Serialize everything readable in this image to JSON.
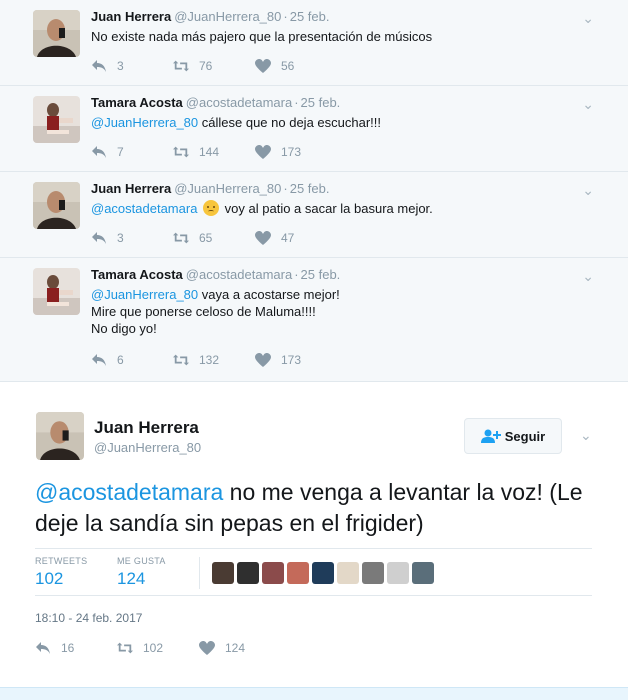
{
  "thread": [
    {
      "name": "Juan Herrera",
      "handle": "@JuanHerrera_80",
      "date": "25 feb.",
      "mention": "",
      "text": "No existe nada más pajero que la presentación de músicos",
      "replies": "3",
      "retweets": "76",
      "likes": "56",
      "avatar_color": "#3a2f28"
    },
    {
      "name": "Tamara Acosta",
      "handle": "@acostadetamara",
      "date": "25 feb.",
      "mention": "@JuanHerrera_80",
      "text": " cállese que no deja escuchar!!!",
      "replies": "7",
      "retweets": "144",
      "likes": "173",
      "avatar_color": "#d9cfc9"
    },
    {
      "name": "Juan Herrera",
      "handle": "@JuanHerrera_80",
      "date": "25 feb.",
      "mention": "@acostadetamara",
      "text": "voy al patio a sacar la basura mejor.",
      "replies": "3",
      "retweets": "65",
      "likes": "47",
      "avatar_color": "#3a2f28"
    },
    {
      "name": "Tamara Acosta",
      "handle": "@acostadetamara",
      "date": "25 feb.",
      "mention": "@JuanHerrera_80",
      "text": " vaya a acostarse mejor!",
      "text_line2": "Mire que ponerse celoso de Maluma!!!!",
      "text_line3": "No digo yo!",
      "replies": "6",
      "retweets": "132",
      "likes": "173",
      "avatar_color": "#d9cfc9"
    }
  ],
  "main": {
    "name": "Juan Herrera",
    "handle": "@JuanHerrera_80",
    "follow_label": "Seguir",
    "mention": "@acostadetamara",
    "text": " no me venga a levantar la voz! (Le deje la sandía sin pepas en el frigider)",
    "retweets_label": "RETWEETS",
    "retweets_count": "102",
    "likes_label": "ME GUSTA",
    "likes_count": "124",
    "timestamp": "18:10 - 24 feb. 2017",
    "replies": "16",
    "retweets": "102",
    "likes": "124"
  },
  "colors": {
    "accent": "#1da1f2",
    "link": "#1b95e0",
    "muted": "#8899a6",
    "like_avatars": [
      "#4a3b33",
      "#2f2f2f",
      "#8b4b4b",
      "#c46a5a",
      "#1f3c5a",
      "#e3d8c8",
      "#7a7a7a",
      "#cfcfcf",
      "#5a6e7a"
    ]
  }
}
